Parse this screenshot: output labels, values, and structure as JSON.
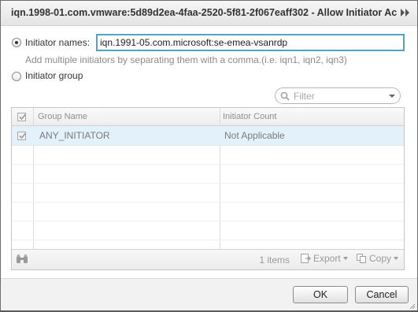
{
  "dialog": {
    "title": "iqn.1998-01.com.vmware:5d89d2ea-4faa-2520-5f81-2f067eaff302 - Allow Initiator Ac..."
  },
  "form": {
    "initiator_names_label": "Initiator names:",
    "initiator_names_value": "iqn.1991-05.com.microsoft:se-emea-vsanrdp",
    "hint": "Add multiple initiators by separating them with a comma.(i.e. iqn1, iqn2, iqn3)",
    "initiator_group_label": "Initiator group",
    "selected_option": "Initiator names"
  },
  "filter": {
    "placeholder": "Filter"
  },
  "grid": {
    "columns": [
      "Group Name",
      "Initiator Count"
    ],
    "rows": [
      {
        "group_name": "ANY_INITIATOR",
        "initiator_count": "Not Applicable",
        "checked": true
      }
    ],
    "item_count": "1 items",
    "export_label": "Export",
    "copy_label": "Copy"
  },
  "buttons": {
    "ok": "OK",
    "cancel": "Cancel"
  }
}
